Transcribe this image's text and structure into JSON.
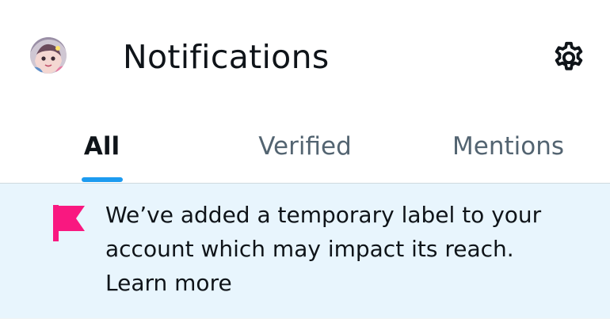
{
  "header": {
    "title": "Notifications",
    "avatar_icon": "profile-avatar",
    "settings_icon": "gear-icon"
  },
  "tabs": [
    {
      "label": "All",
      "active": true
    },
    {
      "label": "Verified",
      "active": false
    },
    {
      "label": "Mentions",
      "active": false
    }
  ],
  "banner": {
    "icon": "flag-icon",
    "message": "We’ve added a temporary label to your account which may impact its reach.",
    "link_label": "Learn more"
  },
  "colors": {
    "accent": "#1d9bf0",
    "banner_bg": "#e8f5fd",
    "flag": "#f91880",
    "text_primary": "#0f1419",
    "text_secondary": "#536471"
  }
}
